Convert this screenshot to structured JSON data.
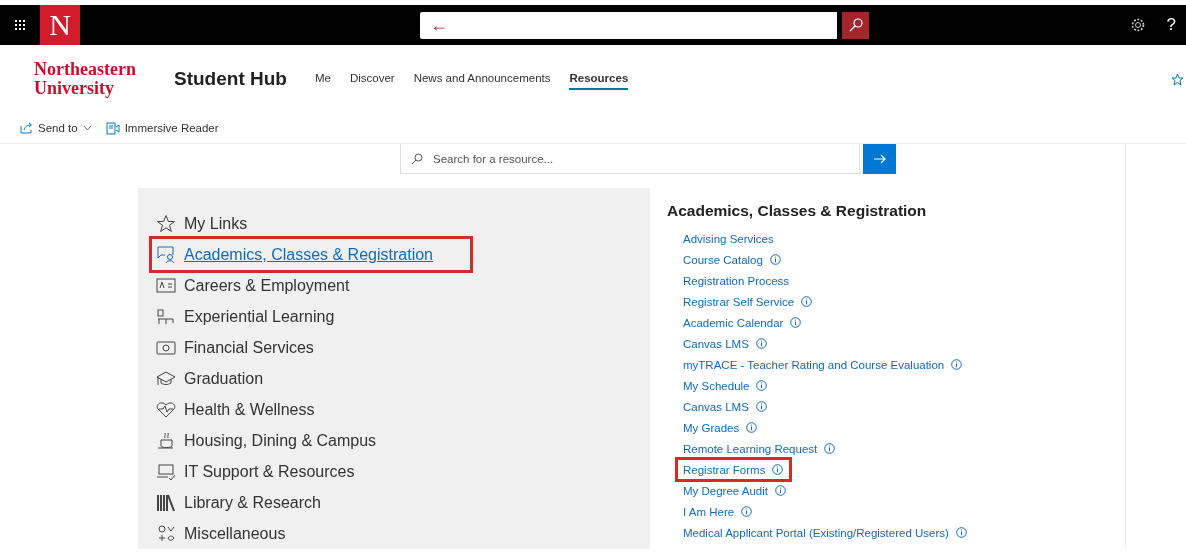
{
  "app_bar": {
    "logo_letter": "N",
    "search": {
      "back": "←"
    },
    "help": "?"
  },
  "site_header": {
    "logo_lines": [
      "Northeastern",
      "University"
    ],
    "title": "Student Hub",
    "nav": [
      {
        "label": "Me",
        "selected": false
      },
      {
        "label": "Discover",
        "selected": false
      },
      {
        "label": "News and Announcements",
        "selected": false
      },
      {
        "label": "Resources",
        "selected": true
      }
    ]
  },
  "command_bar": [
    {
      "label": "Send to",
      "dropdown": true
    },
    {
      "label": "Immersive Reader",
      "dropdown": false
    }
  ],
  "resource_search": {
    "placeholder": "Search for a resource..."
  },
  "categories": [
    {
      "label": "My Links",
      "selected": false,
      "highlighted": false
    },
    {
      "label": "Academics, Classes & Registration",
      "selected": true,
      "highlighted": true
    },
    {
      "label": "Careers & Employment",
      "selected": false,
      "highlighted": false
    },
    {
      "label": "Experiential Learning",
      "selected": false,
      "highlighted": false
    },
    {
      "label": "Financial Services",
      "selected": false,
      "highlighted": false
    },
    {
      "label": "Graduation",
      "selected": false,
      "highlighted": false
    },
    {
      "label": "Health & Wellness",
      "selected": false,
      "highlighted": false
    },
    {
      "label": "Housing, Dining & Campus",
      "selected": false,
      "highlighted": false
    },
    {
      "label": "IT Support & Resources",
      "selected": false,
      "highlighted": false
    },
    {
      "label": "Library & Research",
      "selected": false,
      "highlighted": false
    },
    {
      "label": "Miscellaneous",
      "selected": false,
      "highlighted": false
    }
  ],
  "section": {
    "title": "Academics, Classes & Registration",
    "links": [
      {
        "label": "Advising Services",
        "info": false,
        "highlighted": false
      },
      {
        "label": "Course Catalog",
        "info": true,
        "highlighted": false
      },
      {
        "label": "Registration Process",
        "info": false,
        "highlighted": false
      },
      {
        "label": "Registrar Self Service",
        "info": true,
        "highlighted": false
      },
      {
        "label": "Academic Calendar",
        "info": true,
        "highlighted": false
      },
      {
        "label": "Canvas LMS",
        "info": true,
        "highlighted": false
      },
      {
        "label": "myTRACE - Teacher Rating and Course Evaluation",
        "info": true,
        "highlighted": false
      },
      {
        "label": "My Schedule",
        "info": true,
        "highlighted": false
      },
      {
        "label": "Canvas LMS",
        "info": true,
        "highlighted": false
      },
      {
        "label": "My Grades",
        "info": true,
        "highlighted": false
      },
      {
        "label": "Remote Learning Request",
        "info": true,
        "highlighted": false
      },
      {
        "label": "Registrar Forms",
        "info": true,
        "highlighted": true
      },
      {
        "label": "My Degree Audit",
        "info": true,
        "highlighted": false
      },
      {
        "label": "I Am Here",
        "info": true,
        "highlighted": false
      },
      {
        "label": "Medical Applicant Portal (Existing/Registered Users)",
        "info": true,
        "highlighted": false
      }
    ]
  }
}
